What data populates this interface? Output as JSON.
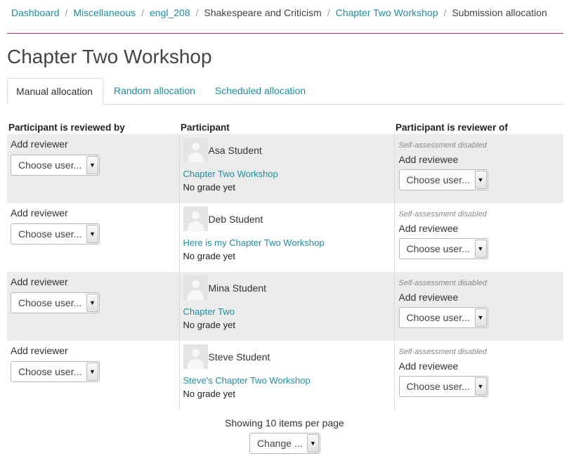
{
  "breadcrumb": {
    "items": [
      "Dashboard",
      "Miscellaneous",
      "engl_208",
      "Shakespeare and Criticism",
      "Chapter Two Workshop",
      "Submission allocation"
    ],
    "separator": "/"
  },
  "page": {
    "title": "Chapter Two Workshop"
  },
  "tabs": [
    {
      "label": "Manual allocation",
      "active": true
    },
    {
      "label": "Random allocation",
      "active": false
    },
    {
      "label": "Scheduled allocation",
      "active": false
    }
  ],
  "table": {
    "headers": [
      "Participant is reviewed by",
      "Participant",
      "Participant is reviewer of"
    ],
    "add_reviewer_label": "Add reviewer",
    "add_reviewee_label": "Add reviewee",
    "choose_user_label": "Choose user...",
    "self_assessment_note": "Self-assessment disabled",
    "rows": [
      {
        "participant": "Asa Student",
        "submission": "Chapter Two Workshop",
        "grade": "No grade yet"
      },
      {
        "participant": "Deb Student",
        "submission": "Here is my Chapter Two Workshop",
        "grade": "No grade yet"
      },
      {
        "participant": "Mina Student",
        "submission": "Chapter Two",
        "grade": "No grade yet"
      },
      {
        "participant": "Steve Student",
        "submission": "Steve's Chapter Two Workshop",
        "grade": "No grade yet"
      }
    ]
  },
  "paging": {
    "showing_text": "Showing 10 items per page",
    "change_label": "Change ..."
  },
  "colors": {
    "link": "#1f8ea0",
    "accent_rule": "#a8306f",
    "row_shade": "#ececec"
  }
}
